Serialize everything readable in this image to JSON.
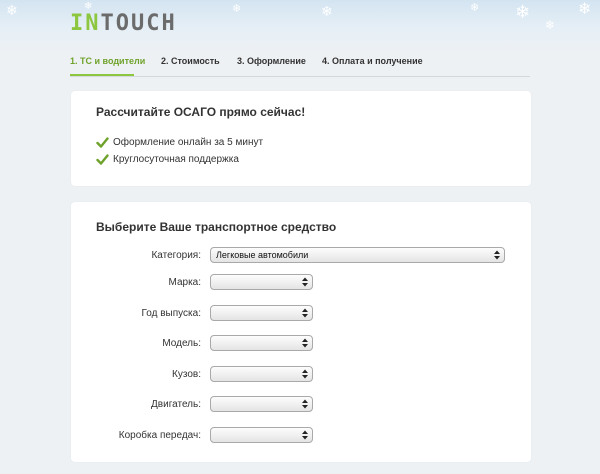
{
  "header": {
    "logo": {
      "prefix": "IN",
      "rest": "TOUCH",
      "icon": "intouch-logo"
    },
    "snowflake_icon": "snowflake-icon",
    "snowflake_glyph": "❄",
    "colors": {
      "accent": "#8dc63f",
      "active_step": "#6ea22a",
      "logo_gray": "#6b6b6b",
      "sky": "#d3e4f1"
    }
  },
  "steps": [
    {
      "label": "1. ТС и водители",
      "active": true
    },
    {
      "label": "2. Стоимость",
      "active": false
    },
    {
      "label": "3. Оформление",
      "active": false
    },
    {
      "label": "4. Оплата и получение",
      "active": false
    }
  ],
  "intro": {
    "title": "Рассчитайте ОСАГО прямо сейчас!",
    "features": [
      {
        "text": "Оформление онлайн за 5 минут",
        "icon": "checkmark-icon"
      },
      {
        "text": "Круглосуточная поддержка",
        "icon": "checkmark-icon"
      }
    ]
  },
  "vehicle_form": {
    "title": "Выберите Ваше транспортное средство",
    "fields": [
      {
        "label": "Категория:",
        "value": "Легковые автомобили"
      },
      {
        "label": "Марка:",
        "value": ""
      },
      {
        "label": "Год выпуска:",
        "value": ""
      },
      {
        "label": "Модель:",
        "value": ""
      },
      {
        "label": "Кузов:",
        "value": ""
      },
      {
        "label": "Двигатель:",
        "value": ""
      },
      {
        "label": "Коробка передач:",
        "value": ""
      }
    ]
  }
}
